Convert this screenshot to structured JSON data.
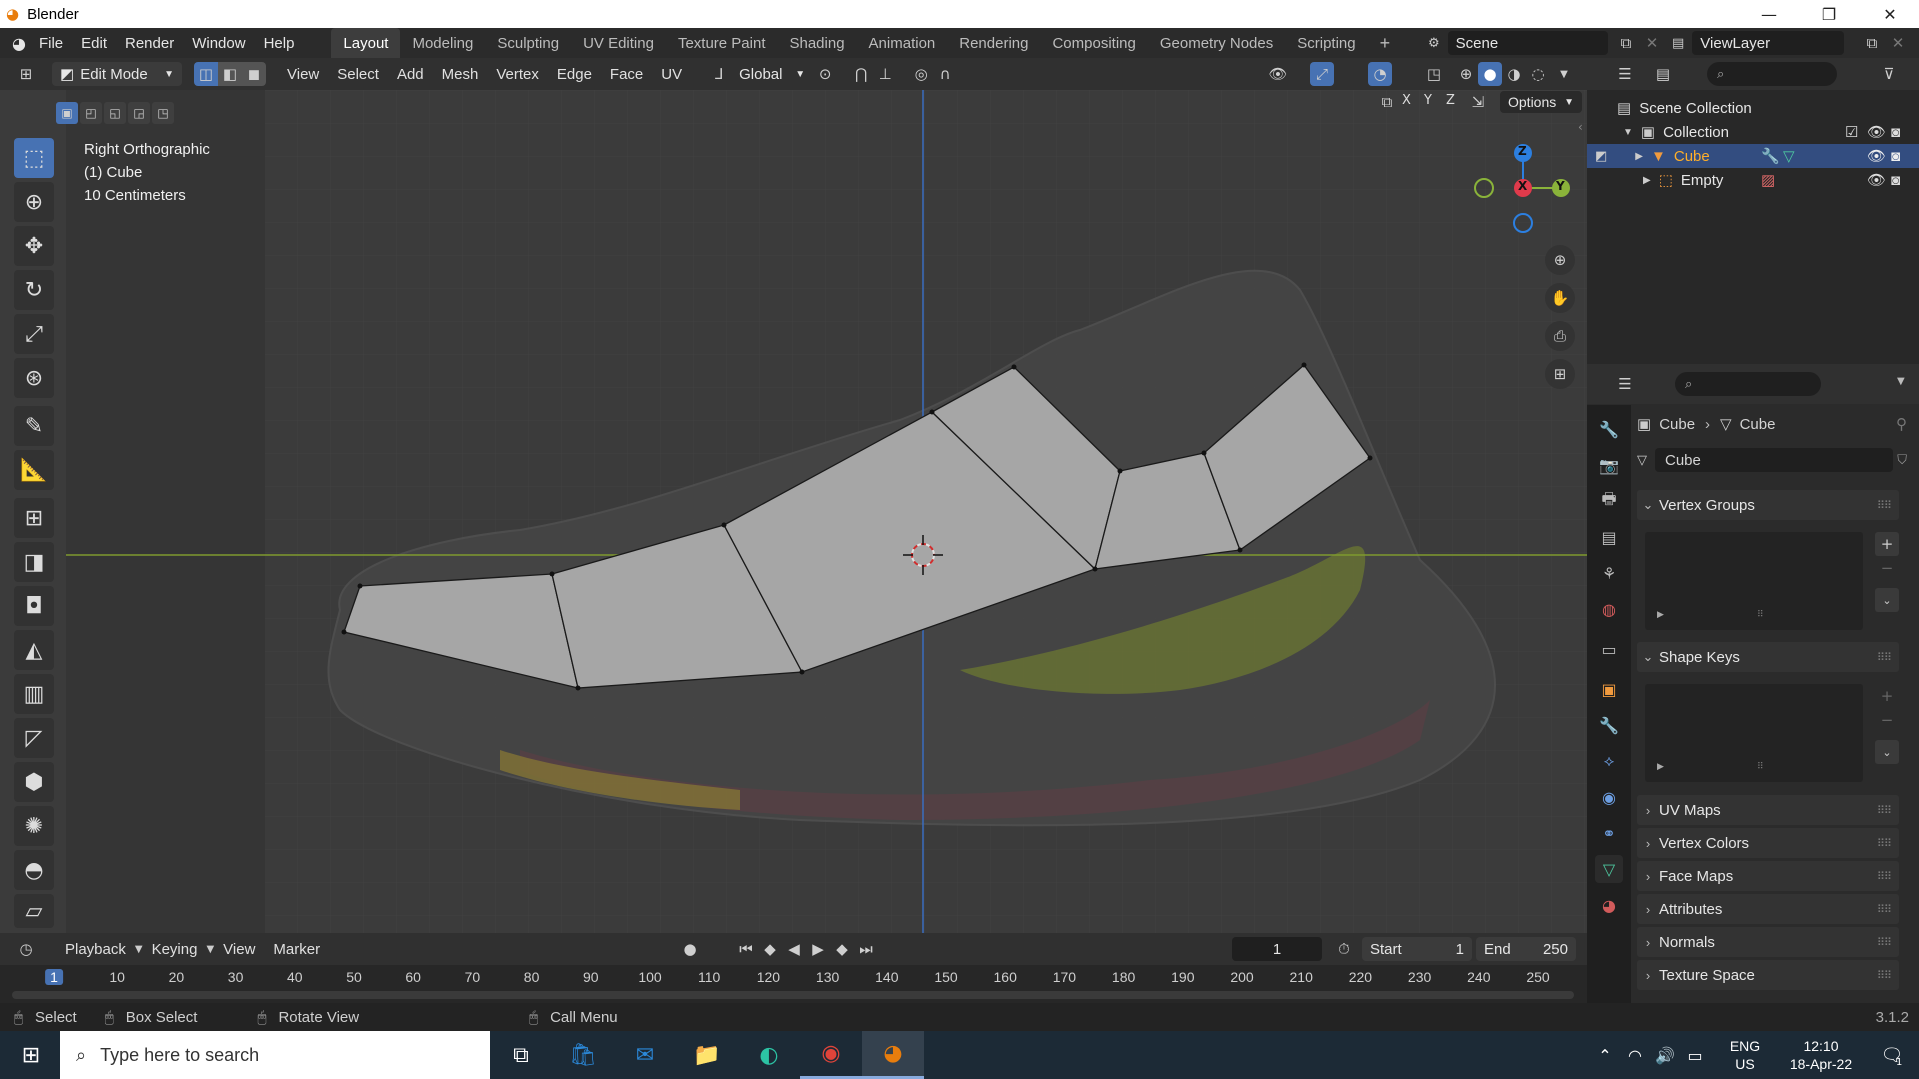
{
  "titlebar": {
    "app_title": "Blender",
    "minimize": "—",
    "maximize": "❐",
    "close": "✕"
  },
  "menu": {
    "items": [
      "File",
      "Edit",
      "Render",
      "Window",
      "Help"
    ]
  },
  "workspaces": {
    "tabs": [
      "Layout",
      "Modeling",
      "Sculpting",
      "UV Editing",
      "Texture Paint",
      "Shading",
      "Animation",
      "Rendering",
      "Compositing",
      "Geometry Nodes",
      "Scripting"
    ],
    "active": "Layout",
    "add": "+"
  },
  "scene": {
    "label": "Scene"
  },
  "view_layer": {
    "label": "ViewLayer"
  },
  "viewport_header": {
    "mode": "Edit Mode",
    "menus": [
      "View",
      "Select",
      "Add",
      "Mesh",
      "Vertex",
      "Edge",
      "Face",
      "UV"
    ],
    "orientation": "Global",
    "options": "Options",
    "axis_x": "X",
    "axis_y": "Y",
    "axis_z": "Z"
  },
  "viewport_info": {
    "line1": "Right Orthographic",
    "line2": "(1) Cube",
    "line3": "10 Centimeters"
  },
  "gizmo": {
    "z": "Z",
    "x": "X",
    "y": "Y"
  },
  "outliner": {
    "scene_collection": "Scene Collection",
    "collection": "Collection",
    "items": [
      {
        "name": "Cube",
        "selected": true
      },
      {
        "name": "Empty",
        "selected": false
      }
    ]
  },
  "properties": {
    "breadcrumb_object": "Cube",
    "breadcrumb_data": "Cube",
    "datablock_name": "Cube",
    "panels": [
      "Vertex Groups",
      "Shape Keys",
      "UV Maps",
      "Vertex Colors",
      "Face Maps",
      "Attributes",
      "Normals",
      "Texture Space"
    ]
  },
  "timeline": {
    "menus": [
      "Playback",
      "Keying",
      "View",
      "Marker"
    ],
    "current_frame": "1",
    "start_label": "Start",
    "start_value": "1",
    "end_label": "End",
    "end_value": "250",
    "ruler": [
      "1",
      "10",
      "20",
      "30",
      "40",
      "50",
      "60",
      "70",
      "80",
      "90",
      "100",
      "110",
      "120",
      "130",
      "140",
      "150",
      "160",
      "170",
      "180",
      "190",
      "200",
      "210",
      "220",
      "230",
      "240",
      "250"
    ]
  },
  "statusbar": {
    "select": "Select",
    "box_select": "Box Select",
    "rotate_view": "Rotate View",
    "call_menu": "Call Menu",
    "version": "3.1.2"
  },
  "taskbar": {
    "search_placeholder": "Type here to search",
    "lang1": "ENG",
    "lang2": "US",
    "time": "12:10",
    "date": "18-Apr-22",
    "notif_count": "1"
  },
  "colors": {
    "accent": "#4772b3",
    "selected_text": "#ffaf29",
    "x_axis": "#e03a4b",
    "y_axis": "#8ab33a",
    "z_axis": "#2c7fe0"
  }
}
